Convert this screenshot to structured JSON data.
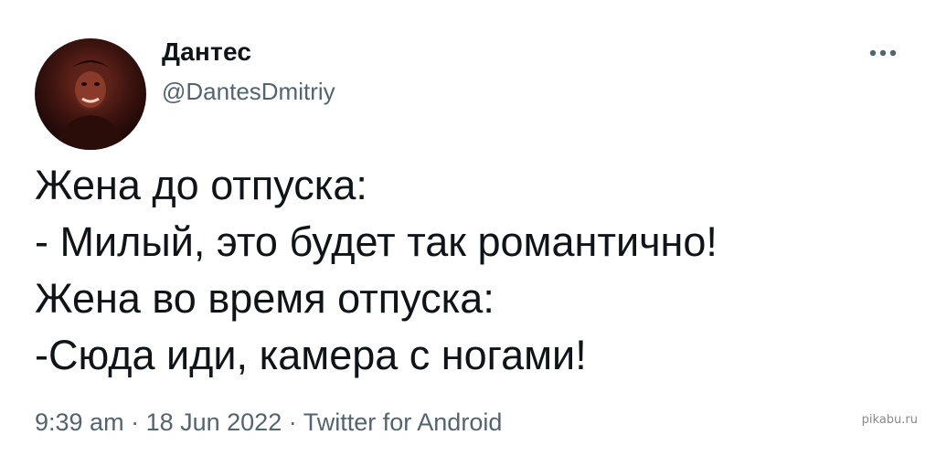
{
  "tweet": {
    "author": {
      "display_name": "Дантес",
      "handle": "@DantesDmitriy"
    },
    "more_icon": "more-horizontal-icon",
    "text_lines": [
      "Жена до отпуска:",
      "- Милый, это будет так романтично!",
      "Жена во время отпуска:",
      "-Сюда иди, камера с ногами!"
    ],
    "meta": {
      "time": "9:39 am",
      "separator": "·",
      "date": "18 Jun 2022",
      "source": "Twitter for Android"
    }
  },
  "watermark": "pikabu.ru",
  "colors": {
    "text": "#0f1419",
    "secondary": "#536471",
    "background": "#ffffff"
  }
}
